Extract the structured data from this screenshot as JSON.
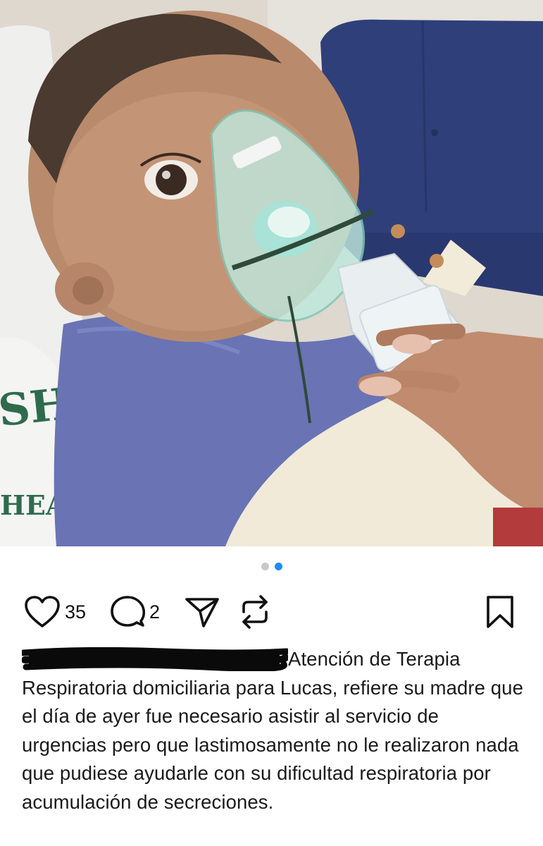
{
  "post": {
    "image": {
      "description_icon": "photo"
    },
    "carousel": {
      "total": 2,
      "active": 2
    },
    "actions": {
      "like_count": "35",
      "comment_count": "2"
    },
    "caption": {
      "redacted_username": "",
      "text": "Atención de Terapia Respiratoria domiciliaria para Lucas, refiere su madre que el día de ayer fue necesario asistir al servicio de urgencias pero que lastimosamente no le realizaron nada que pudiese ayudarle con su dificultad respiratoria por acumulación de secreciones."
    }
  },
  "colors": {
    "accent_dot": "#1d8cf0",
    "inactive_dot": "#c8c8c8",
    "text": "#1a1a1a"
  },
  "icons": [
    "heart-icon",
    "comment-bubble-icon",
    "send-icon",
    "repost-icon",
    "bookmark-icon"
  ]
}
